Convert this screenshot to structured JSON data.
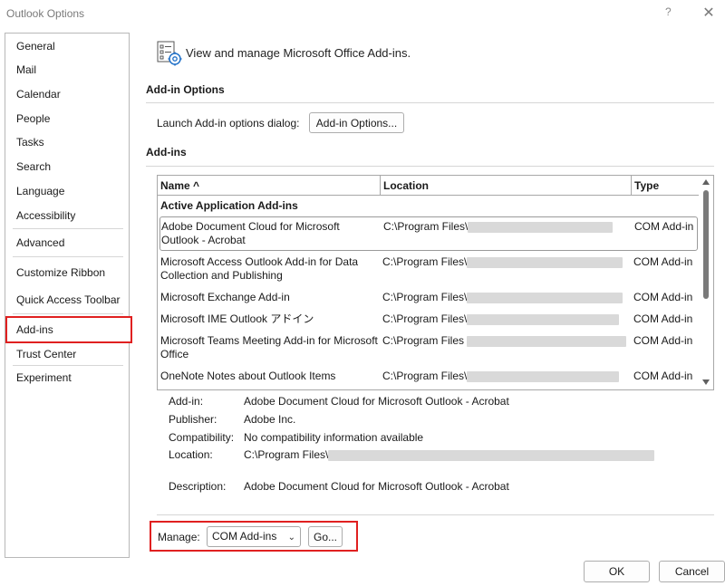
{
  "window": {
    "title": "Outlook Options",
    "help_label": "?",
    "close_glyph": "✕"
  },
  "nav": {
    "items": [
      {
        "label": "General"
      },
      {
        "label": "Mail"
      },
      {
        "label": "Calendar"
      },
      {
        "label": "People"
      },
      {
        "label": "Tasks"
      },
      {
        "label": "Search"
      },
      {
        "label": "Language"
      },
      {
        "label": "Accessibility"
      },
      {
        "label": "Advanced"
      },
      {
        "label": "Customize Ribbon"
      },
      {
        "label": "Quick Access Toolbar"
      },
      {
        "label": "Add-ins"
      },
      {
        "label": "Trust Center"
      },
      {
        "label": "Experiment"
      }
    ],
    "selected": "Add-ins"
  },
  "header": {
    "text": "View and manage Microsoft Office Add-ins.",
    "icon": "addins-settings-icon"
  },
  "addin_options": {
    "title": "Add-in Options",
    "launch_label": "Launch Add-in options dialog:",
    "button_label": "Add-in Options..."
  },
  "addins": {
    "title": "Add-ins",
    "columns": {
      "name": "Name ^",
      "location": "Location",
      "type": "Type"
    },
    "group": "Active Application Add-ins",
    "rows": [
      {
        "name": "Adobe Document Cloud for Microsoft Outlook - Acrobat",
        "location": "C:\\Program Files\\",
        "type": "COM Add-in"
      },
      {
        "name": "Microsoft Access Outlook Add-in for Data Collection and Publishing",
        "location": "C:\\Program Files\\",
        "type": "COM Add-in"
      },
      {
        "name": "Microsoft Exchange Add-in",
        "location": "C:\\Program Files\\",
        "type": "COM Add-in"
      },
      {
        "name": "Microsoft IME Outlook アドイン",
        "location": "C:\\Program Files\\",
        "type": "COM Add-in"
      },
      {
        "name": "Microsoft Teams Meeting Add-in for Microsoft Office",
        "location": "C:\\Program Files",
        "type": "COM Add-in"
      },
      {
        "name": "OneNote Notes about Outlook Items",
        "location": "C:\\Program Files\\",
        "type": "COM Add-in"
      }
    ]
  },
  "details": {
    "addin_label": "Add-in:",
    "addin_value": "Adobe Document Cloud for Microsoft Outlook - Acrobat",
    "publisher_label": "Publisher:",
    "publisher_value": "Adobe Inc.",
    "compat_label": "Compatibility:",
    "compat_value": "No compatibility information available",
    "location_label": "Location:",
    "location_value": "C:\\Program Files\\",
    "description_label": "Description:",
    "description_value": "Adobe Document Cloud for Microsoft Outlook - Acrobat"
  },
  "manage": {
    "label": "Manage:",
    "selected": "COM Add-ins",
    "go_label": "Go..."
  },
  "footer": {
    "ok_label": "OK",
    "cancel_label": "Cancel"
  },
  "colors": {
    "highlight_border": "#e02020"
  }
}
